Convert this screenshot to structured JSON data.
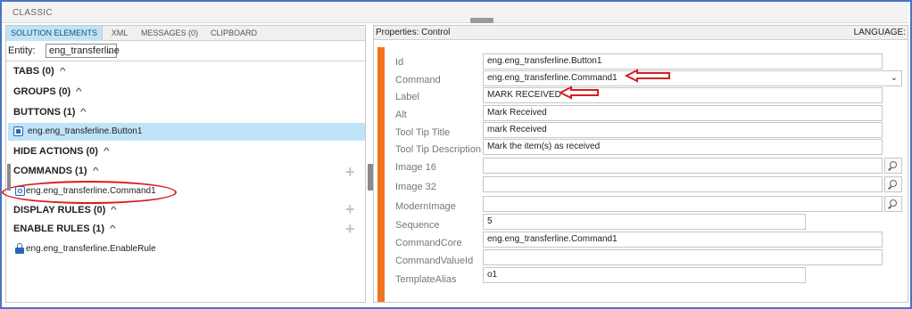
{
  "window": {
    "title": "CLASSIC"
  },
  "left_tabs": [
    "SOLUTION ELEMENTS",
    "XML",
    "MESSAGES (0)",
    "CLIPBOARD"
  ],
  "entity": {
    "label": "Entity:",
    "value": "eng_transferline"
  },
  "sections": {
    "tabs": "TABS (0)",
    "groups": "GROUPS (0)",
    "buttons": "BUTTONS (1)",
    "hide_actions": "HIDE ACTIONS (0)",
    "commands": "COMMANDS (1)",
    "display_rules": "DISPLAY RULES (0)",
    "enable_rules": "ENABLE RULES (1)"
  },
  "items": {
    "button": "eng.eng_transferline.Button1",
    "command": "eng.eng_transferline.Command1",
    "enable_rule": "eng.eng_transferline.EnableRule"
  },
  "right": {
    "title": "Properties: Control",
    "language_label": "LANGUAGE:"
  },
  "properties": [
    {
      "label": "Id",
      "value": "eng.eng_transferline.Button1"
    },
    {
      "label": "Command",
      "value": "eng.eng_transferline.Command1"
    },
    {
      "label": "Label",
      "value": "MARK RECEIVED"
    },
    {
      "label": "Alt",
      "value": "Mark Received"
    },
    {
      "label": "Tool Tip Title",
      "value": "mark Received"
    },
    {
      "label": "Tool Tip Description",
      "value": "Mark the item(s) as received"
    },
    {
      "label": "Image 16",
      "value": ""
    },
    {
      "label": "Image 32",
      "value": ""
    },
    {
      "label": "ModernImage",
      "value": ""
    },
    {
      "label": "Sequence",
      "value": "5"
    },
    {
      "label": "CommandCore",
      "value": "eng.eng_transferline.Command1"
    },
    {
      "label": "CommandValueId",
      "value": ""
    },
    {
      "label": "TemplateAlias",
      "value": "o1"
    }
  ],
  "colors": {
    "frame": "#4a72c4",
    "tab_active": "#bfe4f7",
    "selected_row": "#bfe4f7",
    "accent_bar": "#f0741f",
    "annotation": "#d81e1e",
    "icon": "#2a67b3"
  },
  "icons": [
    "chevron-down-icon",
    "chevron-up-icon",
    "add-icon",
    "button-icon",
    "command-icon",
    "lock-icon",
    "search-icon",
    "arrow-left-icon"
  ]
}
